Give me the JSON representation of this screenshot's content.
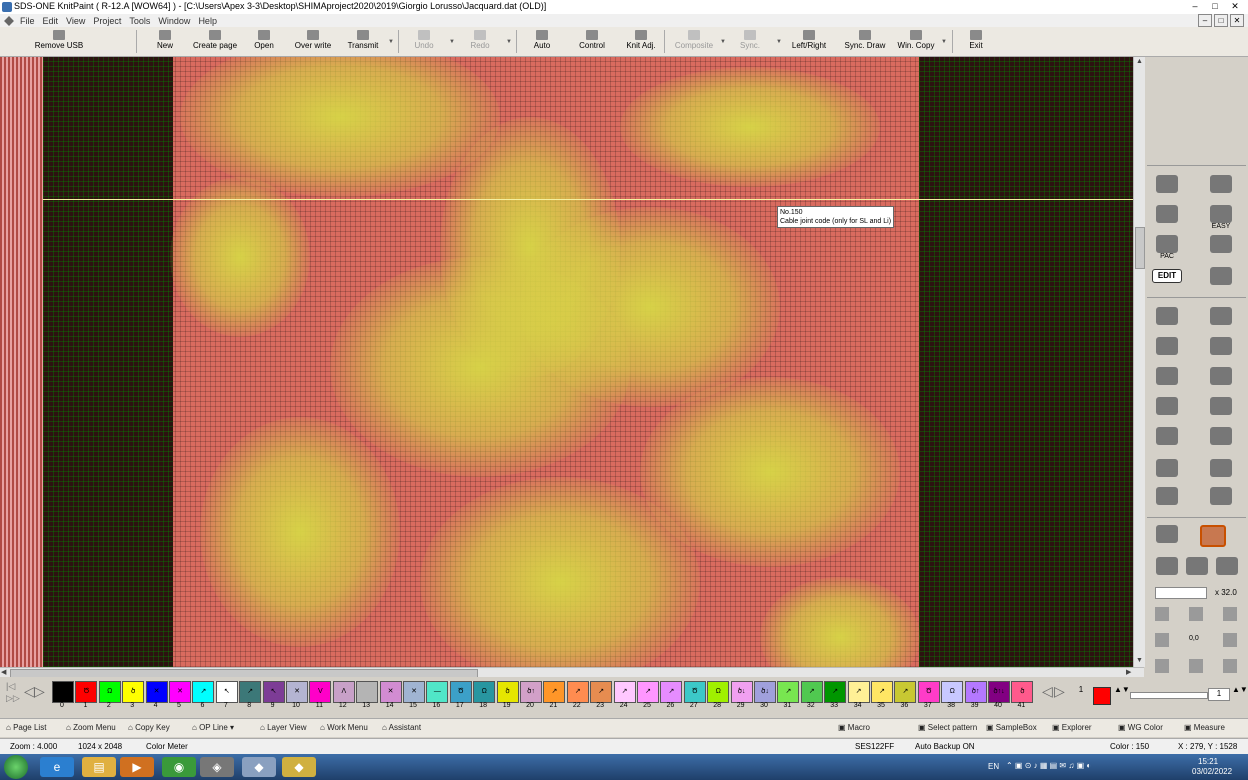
{
  "window": {
    "title": "SDS-ONE KnitPaint ( R-12.A [WOW64] ) - [C:\\Users\\Apex 3-3\\Desktop\\SHIMAproject2020\\2019\\Giorgio Lorusso\\Jacquard.dat (OLD)]",
    "controls": [
      "–",
      "□",
      "✕"
    ]
  },
  "menu": [
    "File",
    "Edit",
    "View",
    "Project",
    "Tools",
    "Window",
    "Help"
  ],
  "toolbar": [
    {
      "label": "Remove USB",
      "icon": "usb-icon",
      "enabled": true
    },
    {
      "label": "New",
      "icon": "new-page-icon",
      "enabled": true
    },
    {
      "label": "Create page",
      "icon": "create-page-icon",
      "enabled": true
    },
    {
      "label": "Open",
      "icon": "open-folder-icon",
      "enabled": true
    },
    {
      "label": "Over write",
      "icon": "save-icon",
      "enabled": true
    },
    {
      "label": "Transmit",
      "icon": "transmit-icon",
      "enabled": true
    },
    {
      "label": "Undo",
      "icon": "undo-icon",
      "enabled": false
    },
    {
      "label": "Redo",
      "icon": "redo-icon",
      "enabled": false
    },
    {
      "label": "Auto",
      "icon": "auto-icon",
      "enabled": true
    },
    {
      "label": "Control",
      "icon": "control-icon",
      "enabled": true
    },
    {
      "label": "Knit Adj.",
      "icon": "knit-adjust-icon",
      "enabled": true
    },
    {
      "label": "Composite",
      "icon": "composite-icon",
      "enabled": false
    },
    {
      "label": "Sync.",
      "icon": "sync-icon",
      "enabled": false
    },
    {
      "label": "Left/Right",
      "icon": "left-right-icon",
      "enabled": true
    },
    {
      "label": "Sync. Draw",
      "icon": "sync-draw-icon",
      "enabled": true
    },
    {
      "label": "Win. Copy",
      "icon": "window-copy-icon",
      "enabled": true
    },
    {
      "label": "Exit",
      "icon": "exit-icon",
      "enabled": true
    }
  ],
  "tooltip": {
    "line1": "No.150",
    "line2": "Cable joint code (only for SL and Li)"
  },
  "palette": {
    "swatches": [
      {
        "n": "0",
        "color": "#000000",
        "glyph": ""
      },
      {
        "n": "1",
        "color": "#ff0000",
        "glyph": "Ծ"
      },
      {
        "n": "2",
        "color": "#00ff00",
        "glyph": "Ω"
      },
      {
        "n": "3",
        "color": "#ffff00",
        "glyph": "ծ"
      },
      {
        "n": "4",
        "color": "#0000ff",
        "glyph": "✕"
      },
      {
        "n": "5",
        "color": "#ff00ff",
        "glyph": "✕"
      },
      {
        "n": "6",
        "color": "#00ffff",
        "glyph": "↗"
      },
      {
        "n": "7",
        "color": "#ffffff",
        "glyph": "↖"
      },
      {
        "n": "8",
        "color": "#3c7878",
        "glyph": "↗"
      },
      {
        "n": "9",
        "color": "#7d3c96",
        "glyph": "↖"
      },
      {
        "n": "10",
        "color": "#b4b4d2",
        "glyph": "✕"
      },
      {
        "n": "11",
        "color": "#ff00c8",
        "glyph": "V"
      },
      {
        "n": "12",
        "color": "#c8a0c8",
        "glyph": "Λ"
      },
      {
        "n": "13",
        "color": "#b4b4b4",
        "glyph": ""
      },
      {
        "n": "14",
        "color": "#d28cd2",
        "glyph": "✕"
      },
      {
        "n": "15",
        "color": "#a0b4d2",
        "glyph": "✕"
      },
      {
        "n": "16",
        "color": "#50e6c8",
        "glyph": "—"
      },
      {
        "n": "17",
        "color": "#3ca0c8",
        "glyph": "Ծ"
      },
      {
        "n": "18",
        "color": "#2896a0",
        "glyph": "Ω"
      },
      {
        "n": "19",
        "color": "#e6e600",
        "glyph": "ծ"
      },
      {
        "n": "20",
        "color": "#d2a0c8",
        "glyph": "ծ↑"
      },
      {
        "n": "21",
        "color": "#ff9628",
        "glyph": "↗"
      },
      {
        "n": "22",
        "color": "#ff8c50",
        "glyph": "↗"
      },
      {
        "n": "23",
        "color": "#e68c50",
        "glyph": "↗"
      },
      {
        "n": "24",
        "color": "#ffc8ff",
        "glyph": "↗"
      },
      {
        "n": "25",
        "color": "#ff96ff",
        "glyph": "↗"
      },
      {
        "n": "26",
        "color": "#e68cff",
        "glyph": "↗"
      },
      {
        "n": "27",
        "color": "#3cc8c8",
        "glyph": "Ծ"
      },
      {
        "n": "28",
        "color": "#a0f000",
        "glyph": "Ω"
      },
      {
        "n": "29",
        "color": "#f0a0f0",
        "glyph": "ծ↓"
      },
      {
        "n": "30",
        "color": "#a0a0dc",
        "glyph": "ծ↓"
      },
      {
        "n": "31",
        "color": "#78e650",
        "glyph": "↗"
      },
      {
        "n": "32",
        "color": "#50c850",
        "glyph": "↗"
      },
      {
        "n": "33",
        "color": "#009600",
        "glyph": "↗"
      },
      {
        "n": "34",
        "color": "#fff096",
        "glyph": "↗"
      },
      {
        "n": "35",
        "color": "#ffe664",
        "glyph": "↗"
      },
      {
        "n": "36",
        "color": "#c8c832",
        "glyph": "↗"
      },
      {
        "n": "37",
        "color": "#ff3cc8",
        "glyph": "Ծ"
      },
      {
        "n": "38",
        "color": "#c8c8ff",
        "glyph": "Ω"
      },
      {
        "n": "39",
        "color": "#b478ff",
        "glyph": "ծ↑"
      },
      {
        "n": "40",
        "color": "#820082",
        "glyph": "ծ↑↓"
      },
      {
        "n": "41",
        "color": "#ff5a8c",
        "glyph": "ծ"
      }
    ],
    "current_number": "1",
    "current_color": "#ff0000",
    "right_value": "1"
  },
  "ops_row": [
    {
      "label": "Page List",
      "icon": "page-list-icon"
    },
    {
      "label": "Zoom Menu",
      "icon": "zoom-menu-icon"
    },
    {
      "label": "Copy Key",
      "icon": "copy-key-icon"
    },
    {
      "label": "OP Line",
      "icon": "op-line-icon"
    },
    {
      "label": "Layer View",
      "icon": "layer-view-icon"
    },
    {
      "label": "Work Menu",
      "icon": "work-menu-icon"
    },
    {
      "label": "Assistant",
      "icon": "assistant-icon"
    },
    {
      "label": "Macro",
      "icon": "macro-icon"
    },
    {
      "label": "Select pattern",
      "icon": "select-pattern-icon"
    },
    {
      "label": "SampleBox",
      "icon": "samplebox-icon"
    },
    {
      "label": "Explorer",
      "icon": "explorer-icon"
    },
    {
      "label": "WG Color",
      "icon": "wg-color-icon"
    },
    {
      "label": "Measure",
      "icon": "measure-icon"
    }
  ],
  "status": {
    "zoom": "Zoom : 4.000",
    "size": "1024 x 2048",
    "meter": "Color Meter",
    "machine": "SES122FF",
    "backup": "Auto Backup ON",
    "color": "Color : 150",
    "coords": "X : 279, Y : 1528"
  },
  "right_panel": {
    "pac_label": "PAC",
    "edit_label": "EDIT",
    "easy_label": "EASY",
    "zoom_value": "x 32.0",
    "center_value": "0,0"
  },
  "taskbar": {
    "apps": [
      "start-orb-icon",
      "internet-explorer-icon",
      "file-explorer-icon",
      "media-player-icon",
      "chrome-icon",
      "knitpaint-icon",
      "shima-icon-1",
      "shima-icon-2"
    ],
    "lang": "EN",
    "time": "15:21",
    "date": "03/02/2022"
  },
  "colors": {
    "canvas_red": "#d96b5f",
    "canvas_yellow": "#d7d746",
    "canvas_dark": "#2c1210"
  }
}
